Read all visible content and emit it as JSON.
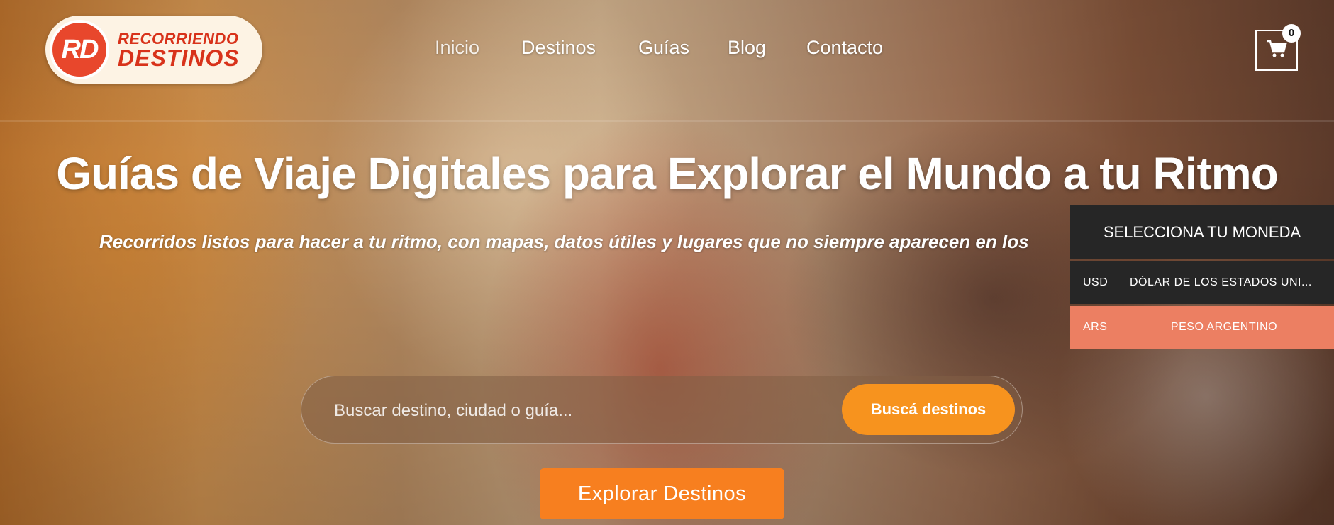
{
  "brand": {
    "badge": "RD",
    "line1": "RECORRIENDO",
    "line2": "DESTINOS"
  },
  "nav": {
    "items": [
      "Inicio",
      "Destinos",
      "Guías",
      "Blog",
      "Contacto"
    ]
  },
  "cart": {
    "count": "0",
    "icon": "cart-icon"
  },
  "hero": {
    "title": "Guías de Viaje Digitales para Explorar el Mundo a tu Ritmo",
    "subtitle": "Recorridos listos para hacer a tu ritmo, con mapas, datos útiles y lugares que no siempre aparecen en los",
    "search_placeholder": "Buscar destino, ciudad o guía...",
    "search_button": "Buscá destinos",
    "cta": "Explorar Destinos"
  },
  "currency": {
    "title": "SELECCIONA TU MONEDA",
    "options": [
      {
        "code": "USD",
        "name": "DÓLAR DE LOS ESTADOS UNI..."
      },
      {
        "code": "ARS",
        "name": "PESO ARGENTINO"
      }
    ]
  },
  "colors": {
    "accent": "#f7931e",
    "cta": "#f77f1f",
    "currency_selected": "#ec7f62",
    "panel_dark": "#262626",
    "brand_red": "#d8321a"
  }
}
